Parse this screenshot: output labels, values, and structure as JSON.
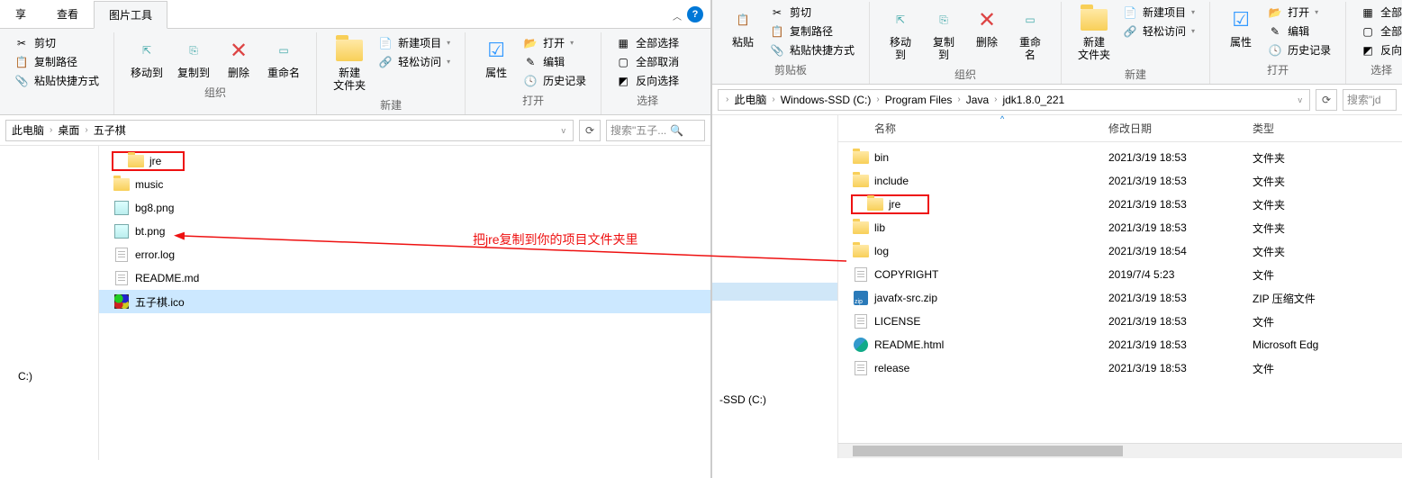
{
  "left": {
    "tabs": {
      "view": "查看",
      "imgtools": "图片工具"
    },
    "ribbon": {
      "clip": {
        "cut": "剪切",
        "copy_path": "复制路径",
        "paste_shortcut": "粘贴快捷方式"
      },
      "org": {
        "move_to": "移动到",
        "copy_to": "复制到",
        "delete": "删除",
        "rename": "重命名",
        "group": "组织"
      },
      "new": {
        "new_folder": "新建\n文件夹",
        "new_item": "新建项目",
        "easy_access": "轻松访问",
        "group": "新建"
      },
      "open": {
        "properties": "属性",
        "open": "打开",
        "edit": "编辑",
        "history": "历史记录",
        "group": "打开"
      },
      "select": {
        "select_all": "全部选择",
        "select_none": "全部取消",
        "invert": "反向选择",
        "group": "选择"
      }
    },
    "breadcrumb": {
      "pc": "此电脑",
      "desktop": "桌面",
      "folder": "五子棋"
    },
    "search_placeholder": "搜索\"五子...",
    "sidebar": {
      "drive": "C:)"
    },
    "files": [
      {
        "name": "jre",
        "type": "folder",
        "box": true
      },
      {
        "name": "music",
        "type": "folder"
      },
      {
        "name": "bg8.png",
        "type": "img"
      },
      {
        "name": "bt.png",
        "type": "img"
      },
      {
        "name": "error.log",
        "type": "txt"
      },
      {
        "name": "README.md",
        "type": "txt"
      },
      {
        "name": "五子棋.ico",
        "type": "ico",
        "sel": true
      }
    ]
  },
  "right": {
    "ribbon": {
      "clip": {
        "cut": "剪切",
        "copy_path": "复制路径",
        "paste_shortcut": "粘贴快捷方式",
        "paste": "粘贴",
        "group": "剪贴板"
      },
      "org": {
        "move_to": "移动到",
        "copy_to": "复制到",
        "delete": "删除",
        "rename": "重命名",
        "group": "组织"
      },
      "new": {
        "new_folder": "新建\n文件夹",
        "new_item": "新建项目",
        "easy_access": "轻松访问",
        "group": "新建"
      },
      "open": {
        "properties": "属性",
        "open": "打开",
        "edit": "编辑",
        "history": "历史记录",
        "group": "打开"
      },
      "select": {
        "select_all": "全部",
        "select_none_partial": "全部",
        "invert": "反向",
        "group": "选择"
      }
    },
    "breadcrumb": {
      "pc": "此电脑",
      "drive": "Windows-SSD (C:)",
      "pf": "Program Files",
      "java": "Java",
      "jdk": "jdk1.8.0_221"
    },
    "search_placeholder": "搜索\"jd",
    "sidebar": {
      "ssd": "-SSD (C:)"
    },
    "columns": {
      "name": "名称",
      "date": "修改日期",
      "type": "类型"
    },
    "files": [
      {
        "name": "bin",
        "type": "folder",
        "date": "2021/3/19 18:53",
        "ftype": "文件夹"
      },
      {
        "name": "include",
        "type": "folder",
        "date": "2021/3/19 18:53",
        "ftype": "文件夹"
      },
      {
        "name": "jre",
        "type": "folder",
        "date": "2021/3/19 18:53",
        "ftype": "文件夹",
        "box": true
      },
      {
        "name": "lib",
        "type": "folder",
        "date": "2021/3/19 18:53",
        "ftype": "文件夹"
      },
      {
        "name": "log",
        "type": "folder",
        "date": "2021/3/19 18:54",
        "ftype": "文件夹"
      },
      {
        "name": "COPYRIGHT",
        "type": "txt",
        "date": "2019/7/4 5:23",
        "ftype": "文件"
      },
      {
        "name": "javafx-src.zip",
        "type": "zip",
        "date": "2021/3/19 18:53",
        "ftype": "ZIP 压缩文件"
      },
      {
        "name": "LICENSE",
        "type": "txt",
        "date": "2021/3/19 18:53",
        "ftype": "文件"
      },
      {
        "name": "README.html",
        "type": "html",
        "date": "2021/3/19 18:53",
        "ftype": "Microsoft Edg"
      },
      {
        "name": "release",
        "type": "txt",
        "date": "2021/3/19 18:53",
        "ftype": "文件"
      }
    ]
  },
  "annotation": "把jre复制到你的项目文件夹里"
}
